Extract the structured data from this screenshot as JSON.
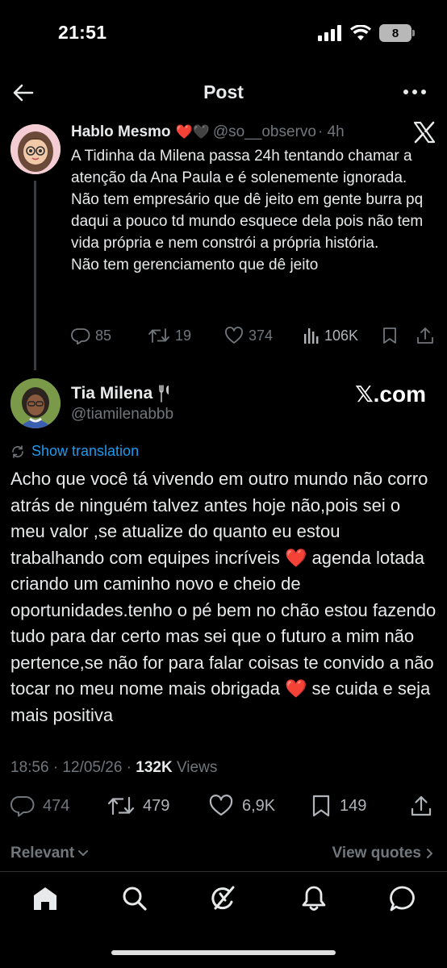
{
  "status_bar": {
    "time": "21:51",
    "battery": "8"
  },
  "header": {
    "title": "Post"
  },
  "quoted_tweet": {
    "name": "Hablo Mesmo",
    "emojis": "❤️🖤",
    "handle": "@so__observo",
    "time": "· 4h",
    "body": [
      "A Tidinha da Milena passa 24h tentando chamar a atenção da Ana Paula e é solenemente ignorada.",
      "Não tem empresário que dê jeito em gente burra pq daqui a pouco td mundo esquece dela pois não tem vida própria e nem constrói a própria história.",
      "Não tem gerenciamento que dê jeito"
    ],
    "replies": "85",
    "reposts": "19",
    "likes": "374",
    "views": "106K"
  },
  "main_tweet": {
    "name": "Tia Milena",
    "handle": "@tiamilenabbb",
    "badge": "𝕏.com",
    "translate_label": "Show translation",
    "body": "Acho que você tá vivendo em outro mundo não corro atrás de ninguém talvez antes hoje não,pois sei o meu valor ,se atualize do quanto eu estou trabalhando com equipes incríveis ❤️ agenda lotada criando um caminho novo e cheio de oportunidades.tenho o pé bem no chão estou fazendo tudo para dar certo mas sei que o futuro a mim não pertence,se não for para falar coisas te convido a não tocar no meu nome mais obrigada ❤️ se cuida e seja mais positiva",
    "timestamp": "18:56 · 12/05/26 · ",
    "views_count": "132K",
    "views_label": " Views",
    "replies": "474",
    "reposts": "479",
    "likes": "6,9K",
    "bookmarks": "149"
  },
  "footer": {
    "relevant_label": "Relevant",
    "view_quotes_label": "View quotes"
  },
  "bottom_nav": [
    "home-icon",
    "search-icon",
    "grok-icon",
    "notifications-icon",
    "messages-icon"
  ],
  "colors": {
    "link": "#1d9bf0",
    "muted": "#71767b",
    "text": "#e7e9ea",
    "heart": "#e0245e"
  }
}
